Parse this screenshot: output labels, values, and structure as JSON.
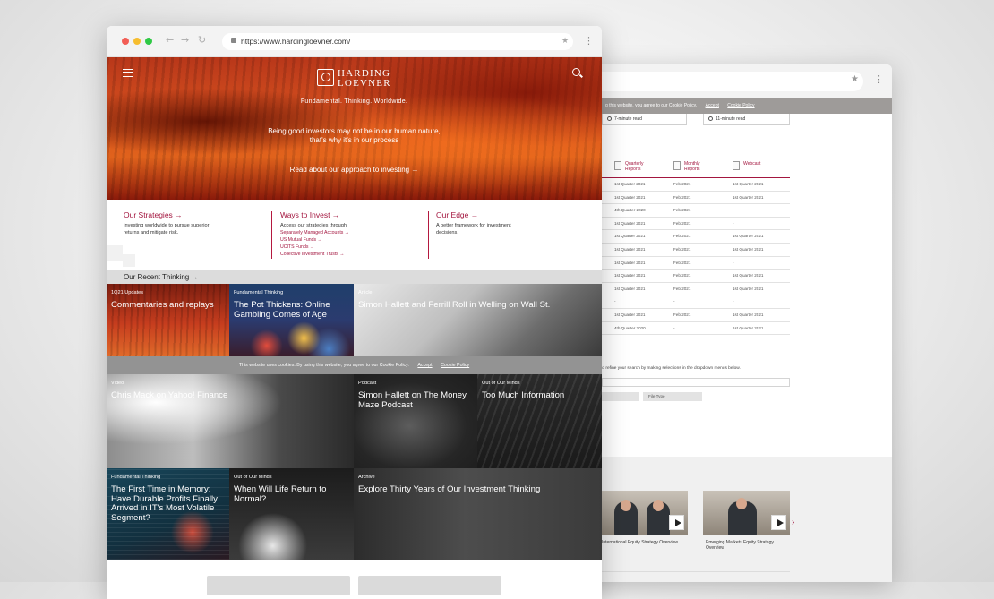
{
  "browser": {
    "url": "https://www.hardingloevner.com/"
  },
  "site": {
    "logo_line1": "HARDING",
    "logo_line2": "LOEVNER",
    "tagline": "Fundamental. Thinking. Worldwide.",
    "hero_line1": "Being good investors may not be in our human nature,",
    "hero_line2": "that's why it's in our process",
    "hero_link": "Read about our approach to investing →"
  },
  "columns": [
    {
      "title": "Our Strategies →",
      "text_lines": [
        "Investing worldwide to pursue superior",
        "returns and mitigate risk."
      ],
      "links": []
    },
    {
      "title": "Ways to Invest →",
      "text_lines": [
        "Access our strategies through"
      ],
      "links": [
        "Separately Managed Accounts →",
        "US Mutual Funds →",
        "UCITS Funds →",
        "Collective Investment Trusts →"
      ]
    },
    {
      "title": "Our Edge →",
      "text_lines": [
        "A better framework for investment",
        "decisions."
      ],
      "links": []
    }
  ],
  "recent": {
    "heading": "Our Recent Thinking →",
    "tiles": [
      {
        "tag": "1Q21 Updates",
        "title_lines": [
          "Commentaries and replays"
        ]
      },
      {
        "tag": "Fundamental Thinking",
        "title_lines": [
          "The Pot Thickens: Online",
          "Gambling Comes of Age"
        ]
      },
      {
        "tag": "Article",
        "title_lines": [
          "Simon Hallett and Ferrill Roll in Welling on Wall St."
        ]
      },
      {
        "tag": "Video",
        "title_lines": [
          "Chris Mack on Yahoo! Finance"
        ]
      },
      {
        "tag": "Podcast",
        "title_lines": [
          "Simon Hallett on The Money",
          "Maze Podcast"
        ]
      },
      {
        "tag": "Out of Our Minds",
        "title_lines": [
          "Too Much Information"
        ]
      },
      {
        "tag": "Fundamental Thinking",
        "title_lines": [
          "The First Time in Memory:",
          "Have Durable Profits Finally",
          "Arrived in IT's Most Volatile",
          "Segment?"
        ]
      },
      {
        "tag": "Out of Our Minds",
        "title_lines": [
          "When Will Life Return to",
          "Normal?"
        ]
      },
      {
        "tag": "Archive",
        "title_lines": [
          "Explore Thirty Years of Our Investment Thinking"
        ]
      }
    ]
  },
  "cookie_banner": {
    "text": "This website uses cookies. By using this website, you agree to our Cookie Policy.",
    "accept": "Accept",
    "policy": "Cookie Policy"
  },
  "back_window": {
    "cookie_text": "g this website, you agree to our Cookie Policy.",
    "accept": "Accept",
    "policy": "Cookie Policy",
    "read_cards": [
      "7-minute read",
      "11-minute read"
    ],
    "table_headers": [
      "Quarterly Reports",
      "Monthly Reports",
      "Webcast"
    ],
    "table_rows": [
      [
        "1st Quarter 2021",
        "Feb 2021",
        "1st Quarter 2021"
      ],
      [
        "1st Quarter 2021",
        "Feb 2021",
        "1st Quarter 2021"
      ],
      [
        "4th Quarter 2020",
        "Feb 2021",
        "-"
      ],
      [
        "1st Quarter 2021",
        "Feb 2021",
        "-"
      ],
      [
        "1st Quarter 2021",
        "Feb 2021",
        "1st Quarter 2021"
      ],
      [
        "1st Quarter 2021",
        "Feb 2021",
        "1st Quarter 2021"
      ],
      [
        "1st Quarter 2021",
        "Feb 2021",
        "-"
      ],
      [
        "1st Quarter 2021",
        "Feb 2021",
        "1st Quarter 2021"
      ],
      [
        "1st Quarter 2021",
        "Feb 2021",
        "1st Quarter 2021"
      ],
      [
        "-",
        "-",
        "-"
      ],
      [
        "1st Quarter 2021",
        "Feb 2021",
        "1st Quarter 2021"
      ],
      [
        "4th Quarter 2020",
        "-",
        "1st Quarter 2021"
      ]
    ],
    "refine_text": "so refine your search by making selections in the dropdown menus below.",
    "file_type": "File Type",
    "videos": [
      "International Equity Strategy Overview",
      "Emerging Markets Equity Strategy Overview"
    ]
  }
}
